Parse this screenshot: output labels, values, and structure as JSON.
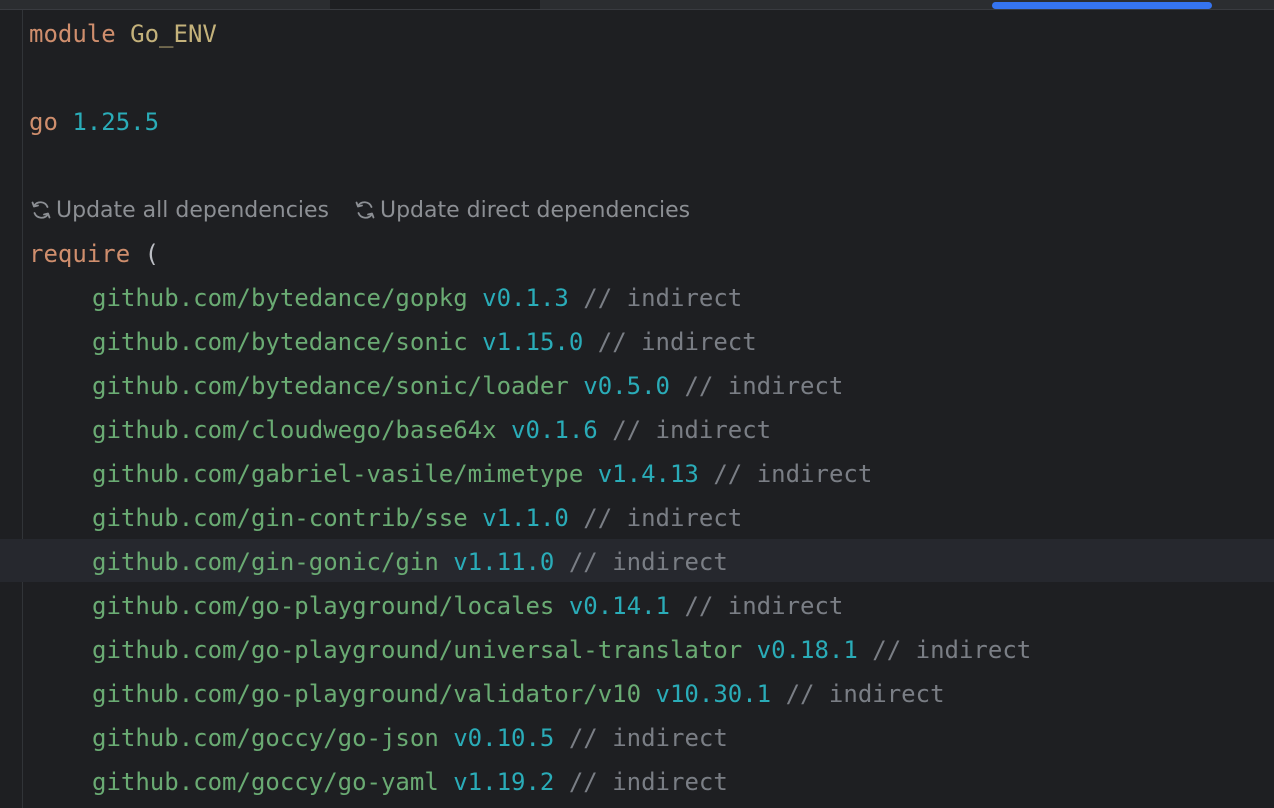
{
  "editor": {
    "module_keyword": "module",
    "module_name": "Go_ENV",
    "go_keyword": "go",
    "go_version": "1.25.5",
    "inlay_actions": [
      {
        "icon": "refresh-icon",
        "label": "Update all dependencies"
      },
      {
        "icon": "refresh-icon",
        "label": "Update direct dependencies"
      }
    ],
    "require_keyword": "require",
    "open_paren": "(",
    "dependencies": [
      {
        "path": "github.com/bytedance/gopkg",
        "version": "v0.1.3",
        "comment": "// indirect"
      },
      {
        "path": "github.com/bytedance/sonic",
        "version": "v1.15.0",
        "comment": "// indirect"
      },
      {
        "path": "github.com/bytedance/sonic/loader",
        "version": "v0.5.0",
        "comment": "// indirect"
      },
      {
        "path": "github.com/cloudwego/base64x",
        "version": "v0.1.6",
        "comment": "// indirect"
      },
      {
        "path": "github.com/gabriel-vasile/mimetype",
        "version": "v1.4.13",
        "comment": "// indirect"
      },
      {
        "path": "github.com/gin-contrib/sse",
        "version": "v1.1.0",
        "comment": "// indirect"
      },
      {
        "path": "github.com/gin-gonic/gin",
        "version": "v1.11.0",
        "comment": "// indirect"
      },
      {
        "path": "github.com/go-playground/locales",
        "version": "v0.14.1",
        "comment": "// indirect"
      },
      {
        "path": "github.com/go-playground/universal-translator",
        "version": "v0.18.1",
        "comment": "// indirect"
      },
      {
        "path": "github.com/go-playground/validator/v10",
        "version": "v10.30.1",
        "comment": "// indirect"
      },
      {
        "path": "github.com/goccy/go-json",
        "version": "v0.10.5",
        "comment": "// indirect"
      },
      {
        "path": "github.com/goccy/go-yaml",
        "version": "v1.19.2",
        "comment": "// indirect"
      }
    ]
  }
}
